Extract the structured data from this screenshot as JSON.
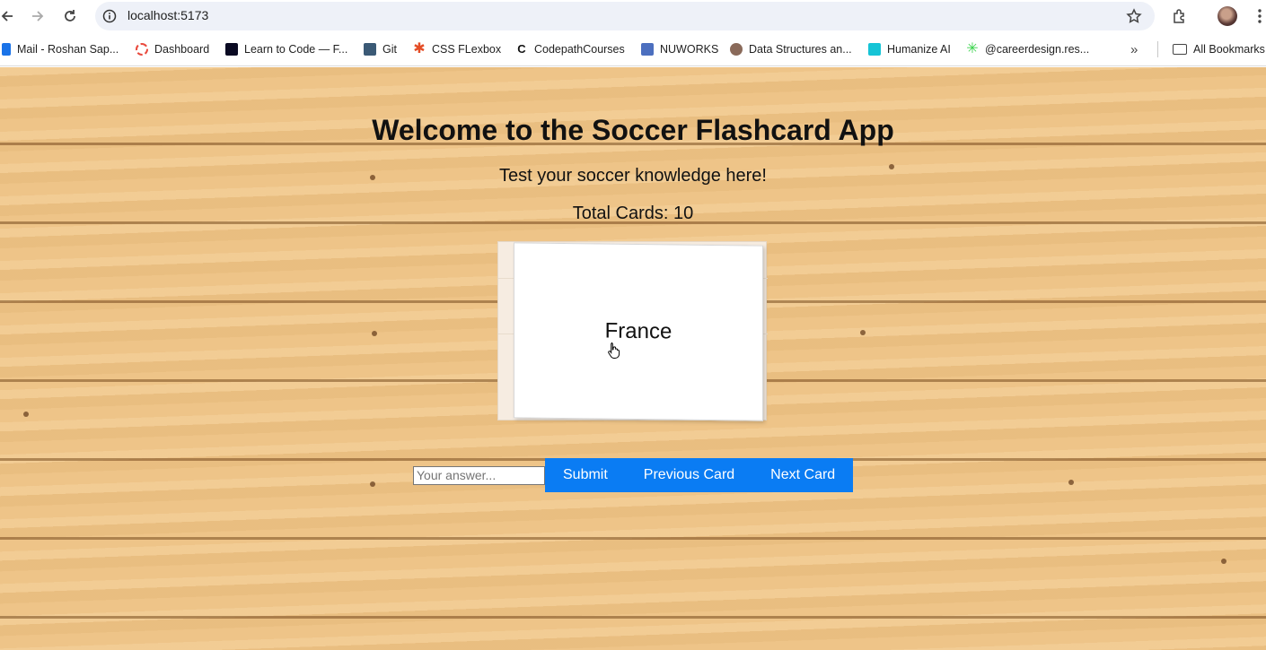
{
  "browser": {
    "url": "localhost:5173",
    "bookmarks": [
      {
        "label": "Mail - Roshan Sap...",
        "color": "#1a73e8"
      },
      {
        "label": "Dashboard",
        "color": "#e94a3d"
      },
      {
        "label": "Learn to Code — F...",
        "color": "#0a0a23"
      },
      {
        "label": "Git",
        "color": "#3b5a76"
      },
      {
        "label": "CSS FLexbox",
        "color": "#e44d26"
      },
      {
        "label": "CodepathCourses",
        "color": "#111111"
      },
      {
        "label": "NUWORKS",
        "color": "#4c6fbf"
      },
      {
        "label": "Data Structures an...",
        "color": "#8a6a5a"
      },
      {
        "label": "Humanize AI",
        "color": "#16c4d6"
      },
      {
        "label": "@careerdesign.res...",
        "color": "#3ad34c"
      }
    ],
    "all_bookmarks_label": "All Bookmarks"
  },
  "app": {
    "title": "Welcome to the Soccer Flashcard App",
    "subtitle": "Test your soccer knowledge here!",
    "total_cards": "Total Cards: 10",
    "card_text": "France",
    "answer_placeholder": "Your answer...",
    "buttons": {
      "submit": "Submit",
      "previous": "Previous Card",
      "next": "Next Card"
    },
    "accent_color": "#0a7cf3"
  }
}
